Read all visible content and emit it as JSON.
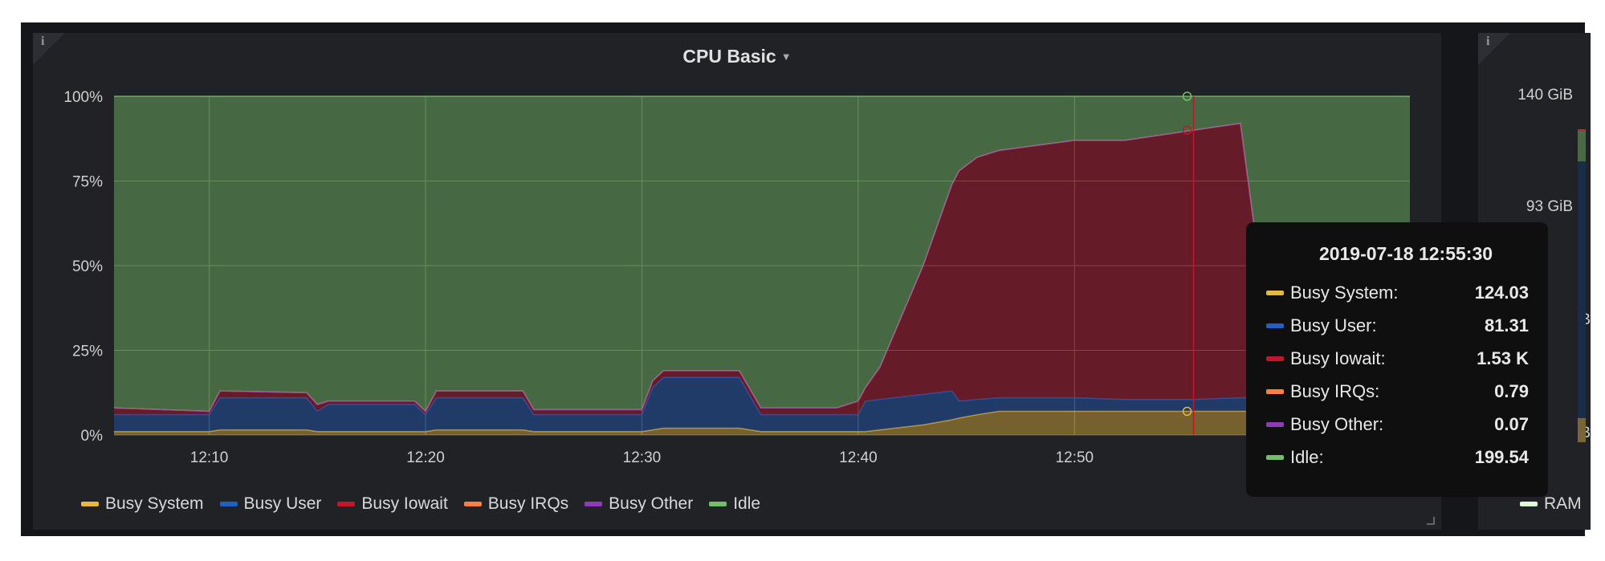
{
  "panel": {
    "title": "CPU Basic",
    "info_icon": "i"
  },
  "colors": {
    "system": "#eab839",
    "user": "#1f60c4",
    "iowait": "#c4162a",
    "irqs": "#ff7f3c",
    "other": "#8f3bb8",
    "idle": "#73bf69"
  },
  "chart_data": {
    "type": "area",
    "stacked": true,
    "title": "CPU Basic",
    "y_ticks": [
      "0%",
      "25%",
      "50%",
      "75%",
      "100%"
    ],
    "ylim": [
      0,
      100
    ],
    "x_ticks": [
      "12:10",
      "12:20",
      "12:30",
      "12:40",
      "12:50"
    ],
    "xlim": [
      "12:05:36",
      "13:05:30"
    ],
    "grid": true,
    "legend_placement": "bottom",
    "x": [
      "12:05:36",
      "12:10:00",
      "12:10:30",
      "12:14:30",
      "12:15:00",
      "12:15:30",
      "12:19:30",
      "12:20:00",
      "12:20:30",
      "12:24:30",
      "12:25:00",
      "12:30:00",
      "12:30:30",
      "12:31:00",
      "12:34:30",
      "12:35:30",
      "12:39:00",
      "12:40:00",
      "12:40:20",
      "12:41:00",
      "12:43:00",
      "12:44:20",
      "12:44:40",
      "12:45:30",
      "12:46:30",
      "12:50:00",
      "12:52:20",
      "12:55:30",
      "12:57:40",
      "12:58:20",
      "12:59:00",
      "13:05:30"
    ],
    "series": [
      {
        "name": "Busy System",
        "key": "system",
        "values": [
          1,
          1,
          1.5,
          1.5,
          1,
          1,
          1,
          1,
          1.5,
          1.5,
          1,
          1,
          1.5,
          2,
          2,
          1,
          1,
          1,
          1,
          1.5,
          3,
          4.5,
          5,
          6,
          7,
          7,
          7,
          7,
          7,
          7,
          7,
          7
        ]
      },
      {
        "name": "Busy User",
        "key": "user",
        "values": [
          5,
          5,
          9.5,
          9.5,
          6,
          8,
          8,
          5,
          9.5,
          9.5,
          5,
          5,
          12.5,
          15,
          15,
          5,
          5,
          5,
          9,
          9,
          9,
          8.5,
          5,
          4.5,
          4,
          4,
          3.5,
          3.5,
          4,
          4,
          4,
          4
        ]
      },
      {
        "name": "Busy Iowait",
        "key": "iowait",
        "values": [
          2,
          1,
          2,
          1.5,
          2,
          1,
          1,
          1,
          2,
          2,
          1.5,
          1.5,
          2,
          2,
          2,
          2,
          2,
          4,
          4,
          9.5,
          38,
          61,
          68,
          71.5,
          73,
          76,
          76.5,
          79.5,
          81,
          49,
          3,
          3
        ]
      },
      {
        "name": "Busy IRQs",
        "key": "irqs",
        "values": [
          0,
          0,
          0,
          0,
          0,
          0,
          0,
          0,
          0,
          0,
          0,
          0,
          0,
          0,
          0,
          0,
          0,
          0,
          0,
          0,
          0,
          0,
          0,
          0,
          0,
          0,
          0,
          0,
          0,
          0,
          0,
          0
        ]
      },
      {
        "name": "Busy Other",
        "key": "other",
        "values": [
          0,
          0,
          0,
          0,
          0,
          0,
          0,
          0,
          0,
          0,
          0,
          0,
          0,
          0,
          0,
          0,
          0,
          0,
          0,
          0,
          0,
          0,
          0,
          0,
          0,
          0,
          0,
          0,
          0,
          0,
          0,
          0
        ]
      },
      {
        "name": "Idle",
        "key": "idle",
        "values": [
          92,
          93,
          87,
          87.5,
          91,
          90,
          90,
          93,
          87,
          87,
          92.5,
          92.5,
          84,
          81,
          81,
          92,
          92,
          90,
          86,
          80,
          50,
          26,
          22,
          18,
          16,
          13,
          13,
          10,
          8,
          40,
          86,
          86
        ]
      }
    ],
    "hover_time": "12:55:30"
  },
  "legend": [
    {
      "label": "Busy System",
      "key": "system"
    },
    {
      "label": "Busy User",
      "key": "user"
    },
    {
      "label": "Busy Iowait",
      "key": "iowait"
    },
    {
      "label": "Busy IRQs",
      "key": "irqs"
    },
    {
      "label": "Busy Other",
      "key": "other"
    },
    {
      "label": "Idle",
      "key": "idle"
    }
  ],
  "tooltip": {
    "time": "2019-07-18 12:55:30",
    "rows": [
      {
        "label": "Busy System:",
        "value": "124.03",
        "key": "system"
      },
      {
        "label": "Busy User:",
        "value": "81.31",
        "key": "user"
      },
      {
        "label": "Busy Iowait:",
        "value": "1.53 K",
        "key": "iowait"
      },
      {
        "label": "Busy IRQs:",
        "value": "0.79",
        "key": "irqs"
      },
      {
        "label": "Busy Other:",
        "value": "0.07",
        "key": "other"
      },
      {
        "label": "Idle:",
        "value": "199.54",
        "key": "idle"
      }
    ]
  },
  "right_panel": {
    "info_icon": "i",
    "y_labels": [
      "140 GiB",
      "93 GiB",
      "iB",
      "B"
    ],
    "legend_label": "RAM",
    "legend_color": "#e0f9d7"
  }
}
